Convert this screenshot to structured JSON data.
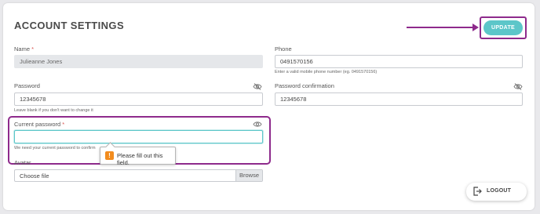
{
  "page": {
    "title": "ACCOUNT SETTINGS"
  },
  "actions": {
    "update_label": "UPDATE",
    "logout_label": "LOGOUT"
  },
  "form": {
    "name": {
      "label": "Name",
      "required_mark": "*",
      "value": "Julieanne Jones"
    },
    "phone": {
      "label": "Phone",
      "value": "0491570156",
      "hint": "Enter a valid mobile phone number (eg. 0491570156)"
    },
    "password": {
      "label": "Password",
      "value": "12345678",
      "hint": "Leave blank if you don't want to change it"
    },
    "password_confirmation": {
      "label": "Password confirmation",
      "value": "12345678"
    },
    "current_password": {
      "label": "Current password",
      "required_mark": "*",
      "value": "",
      "hint": "We need your current password to confirm"
    },
    "avatar": {
      "label": "Avatar",
      "file_label": "Choose file",
      "browse_label": "Browse"
    }
  },
  "validation": {
    "message": "Please fill out this field.",
    "icon": "!"
  },
  "annotation": {
    "color": "#8e2a8c"
  },
  "colors": {
    "accent": "#5cc6c9",
    "warning": "#f28c1e"
  }
}
